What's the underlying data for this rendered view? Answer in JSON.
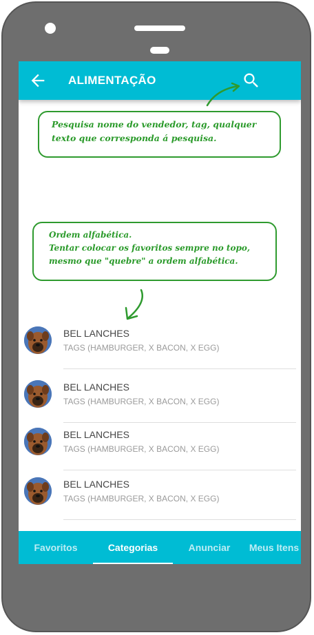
{
  "appbar": {
    "title": "ALIMENTAÇÃO",
    "back_icon": "arrow-back-icon",
    "search_icon": "search-icon"
  },
  "notes": {
    "search": "Pesquisa nome do vendedor, tag, qualquer texto que corresponda á pesquisa.",
    "order_line1": "Ordem alfabética.",
    "order_line2": "Tentar colocar os favoritos sempre no topo,",
    "order_line3": "mesmo que \"quebre\" a ordem alfabética."
  },
  "list": {
    "items": [
      {
        "name": "BEL LANCHES",
        "tags": "TAGS (HAMBURGER, X BACON, X EGG)"
      },
      {
        "name": "BEL LANCHES",
        "tags": "TAGS (HAMBURGER, X BACON, X EGG)"
      },
      {
        "name": "BEL LANCHES",
        "tags": "TAGS (HAMBURGER, X BACON, X EGG)"
      },
      {
        "name": "BEL LANCHES",
        "tags": "TAGS (HAMBURGER, X BACON, X EGG)"
      }
    ]
  },
  "tabs": [
    {
      "label": "Favoritos",
      "active": false
    },
    {
      "label": "Categorias",
      "active": true
    },
    {
      "label": "Anunciar",
      "active": false
    },
    {
      "label": "Meus Itens",
      "active": false
    }
  ],
  "colors": {
    "primary": "#00bcd4",
    "note_green": "#2e9a2e"
  }
}
